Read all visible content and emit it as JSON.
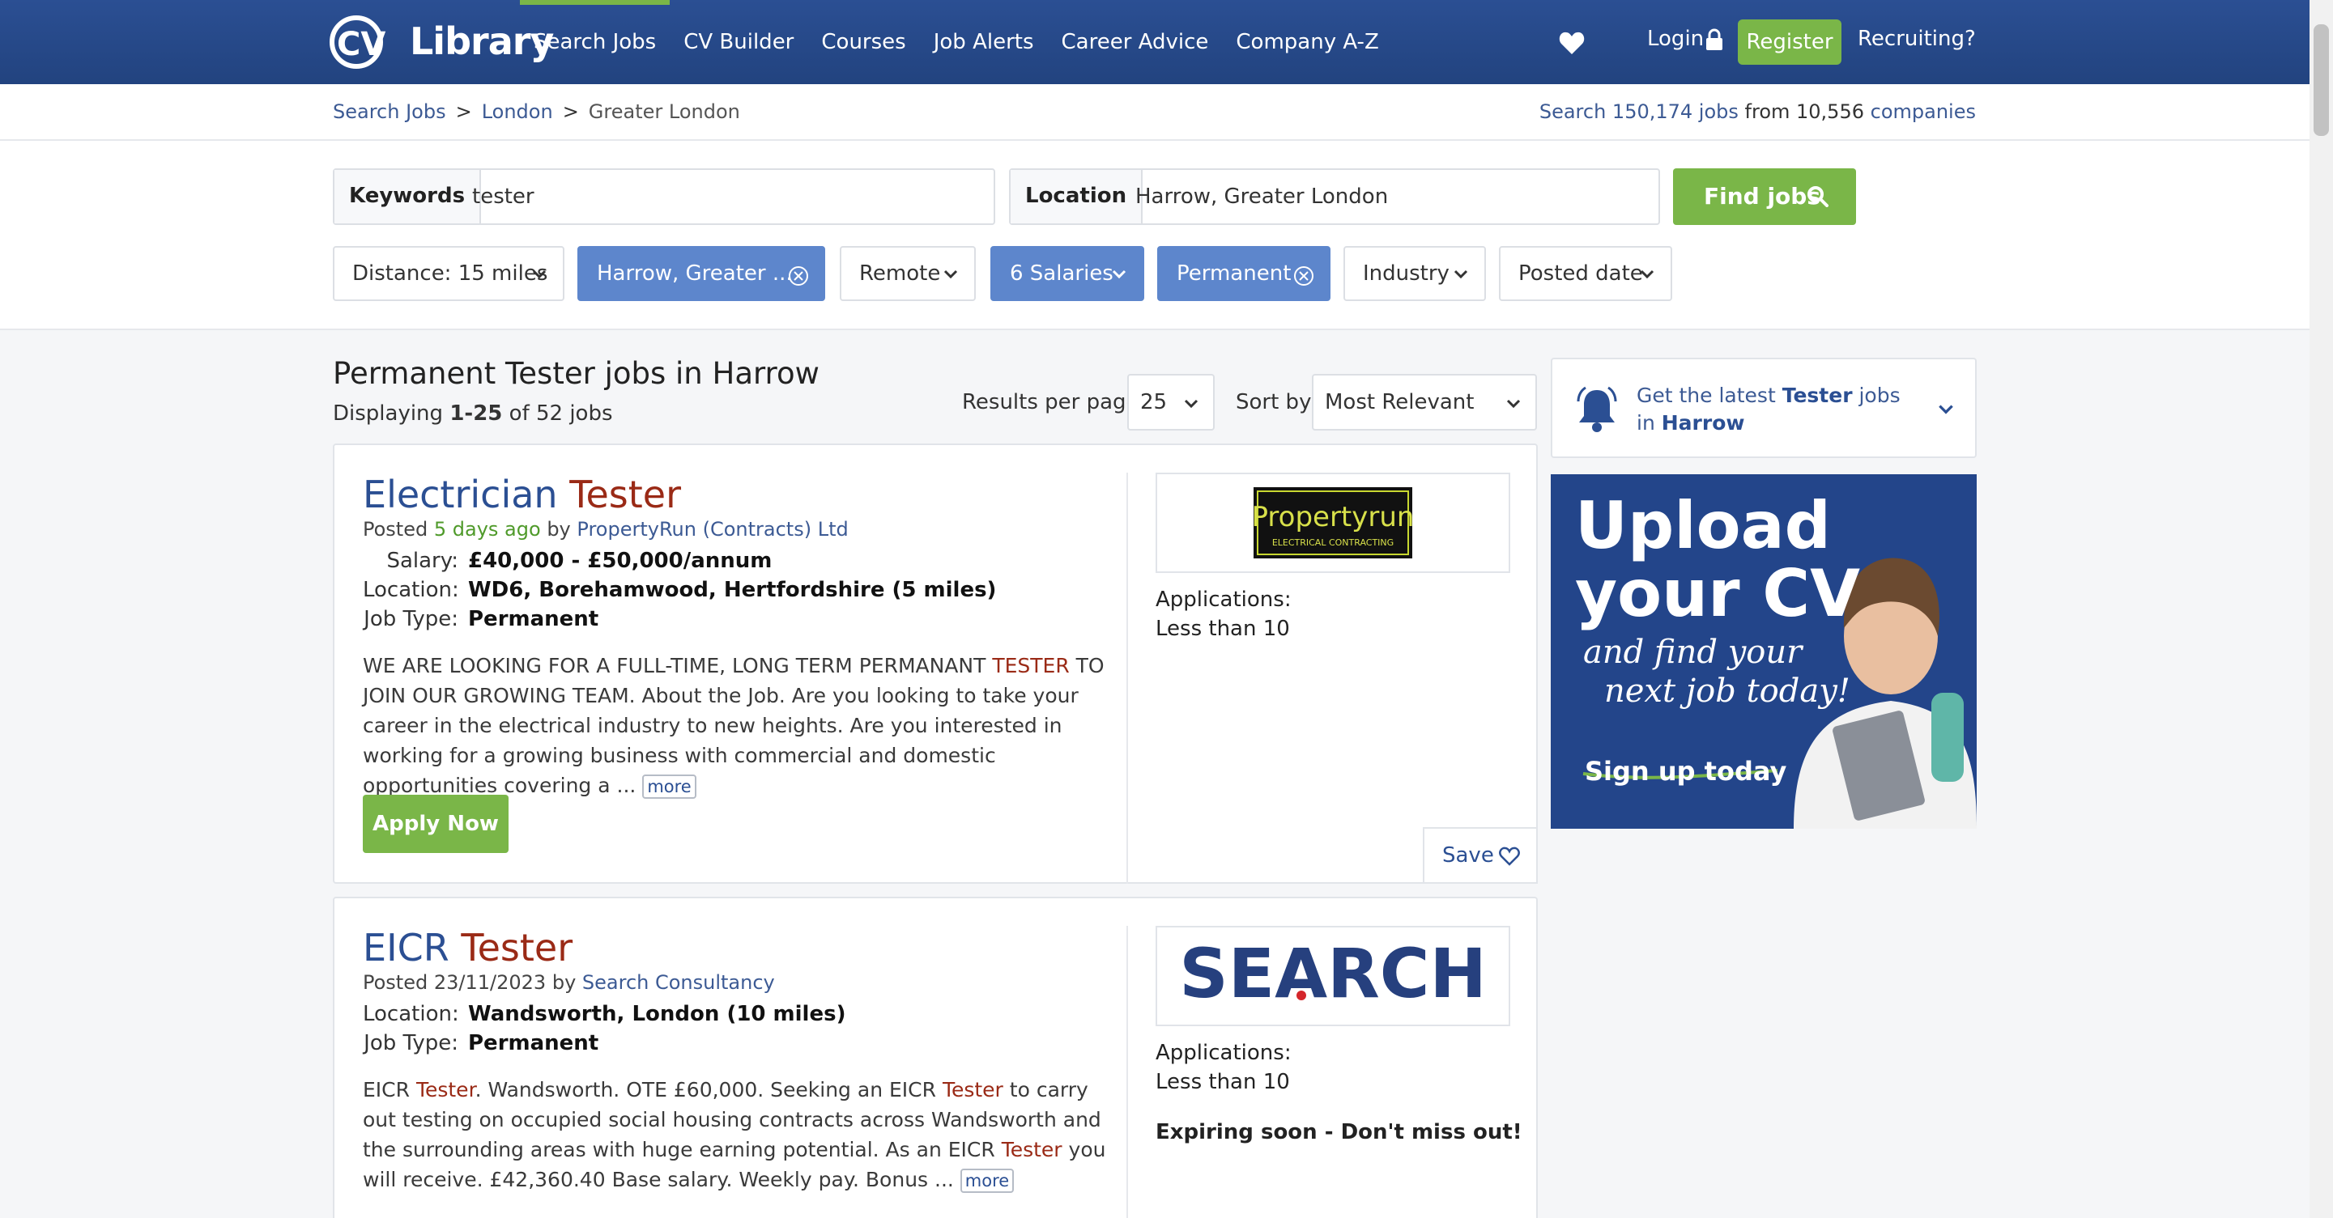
{
  "header": {
    "logo_text": "Library",
    "nav": [
      "Search Jobs",
      "CV Builder",
      "Courses",
      "Job Alerts",
      "Career Advice",
      "Company A-Z"
    ],
    "login": "Login",
    "register": "Register",
    "recruiting": "Recruiting?"
  },
  "breadcrumb": {
    "items": [
      "Search Jobs",
      "London",
      "Greater London"
    ],
    "sep": ">"
  },
  "stats": {
    "prefix": "Search",
    "jobs": "150,174 jobs",
    "from": "from 10,556",
    "companies": "companies"
  },
  "search": {
    "keywords_label": "Keywords",
    "keywords_value": "tester",
    "location_label": "Location",
    "location_value": "Harrow, Greater London",
    "find_button": "Find jobs"
  },
  "filters": {
    "distance": "Distance: 15 miles",
    "location": "Harrow, Greater ...",
    "remote": "Remote",
    "salaries": "6 Salaries",
    "permanent": "Permanent",
    "industry": "Industry",
    "posted_date": "Posted date"
  },
  "results": {
    "title": "Permanent Tester jobs in Harrow",
    "displaying": "Displaying",
    "range": "1-25",
    "of_total": "of 52 jobs",
    "per_page_label": "Results per page:",
    "per_page_value": "25",
    "sort_label": "Sort by:",
    "sort_value": "Most Relevant"
  },
  "jobs": [
    {
      "title_a": "Electrician",
      "title_b": "Tester",
      "posted_prefix": "Posted",
      "posted_when": "5 days ago",
      "by": "by",
      "company": "PropertyRun (Contracts) Ltd",
      "salary_label": "Salary:",
      "salary": "£40,000 - £50,000/annum",
      "location_label": "Location:",
      "location": "WD6, Borehamwood, Hertfordshire (5 miles)",
      "type_label": "Job Type:",
      "type": "Permanent",
      "desc_1": "WE ARE LOOKING FOR A FULL-TIME, LONG TERM PERMANANT ",
      "desc_hl": "TESTER",
      "desc_2": " TO JOIN OUR GROWING TEAM. About the Job. Are you looking to take your career in the electrical industry to new heights. Are you interested in working for a growing business with commercial and domestic opportunities covering a ... ",
      "more": "more",
      "apply": "Apply Now",
      "logo_text": "Propertyrun",
      "logo_sub": "ELECTRICAL CONTRACTING",
      "apps_label": "Applications:",
      "apps_value": "Less than 10",
      "save": "Save"
    },
    {
      "title_a": "EICR",
      "title_b": "Tester",
      "posted_prefix": "Posted",
      "posted_when": "23/11/2023",
      "by": "by",
      "company": "Search Consultancy",
      "location_label": "Location:",
      "location": "Wandsworth, London (10 miles)",
      "type_label": "Job Type:",
      "type": "Permanent",
      "d1": "EICR ",
      "h1": "Tester",
      "d2": ". Wandsworth. OTE £60,000. Seeking an EICR ",
      "h2": "Tester",
      "d3": " to carry out testing on occupied social housing contracts across Wandsworth and the surrounding areas with huge earning potential. As an EICR ",
      "h3": "Tester",
      "d4": " you will receive. £42,360.40 Base salary. Weekly pay. Bonus ... ",
      "more": "more",
      "logo_text": "SEARCH",
      "apps_label": "Applications:",
      "apps_value": "Less than 10",
      "expiring": "Expiring soon - Don't miss out!"
    }
  ],
  "alert": {
    "pre": "Get the latest",
    "term": "Tester",
    "mid": "jobs in",
    "place": "Harrow"
  },
  "promo": {
    "headline_1": "Upload",
    "headline_2": "your CV",
    "script_1": "and find your",
    "script_2": "next job today!",
    "cta": "Sign up today"
  },
  "colors": {
    "header_blue": "#22437f",
    "accent_green": "#7ab648",
    "chip_active": "#5d86cc",
    "highlight_red": "#9a2a16",
    "link_blue": "#3c5a94"
  }
}
